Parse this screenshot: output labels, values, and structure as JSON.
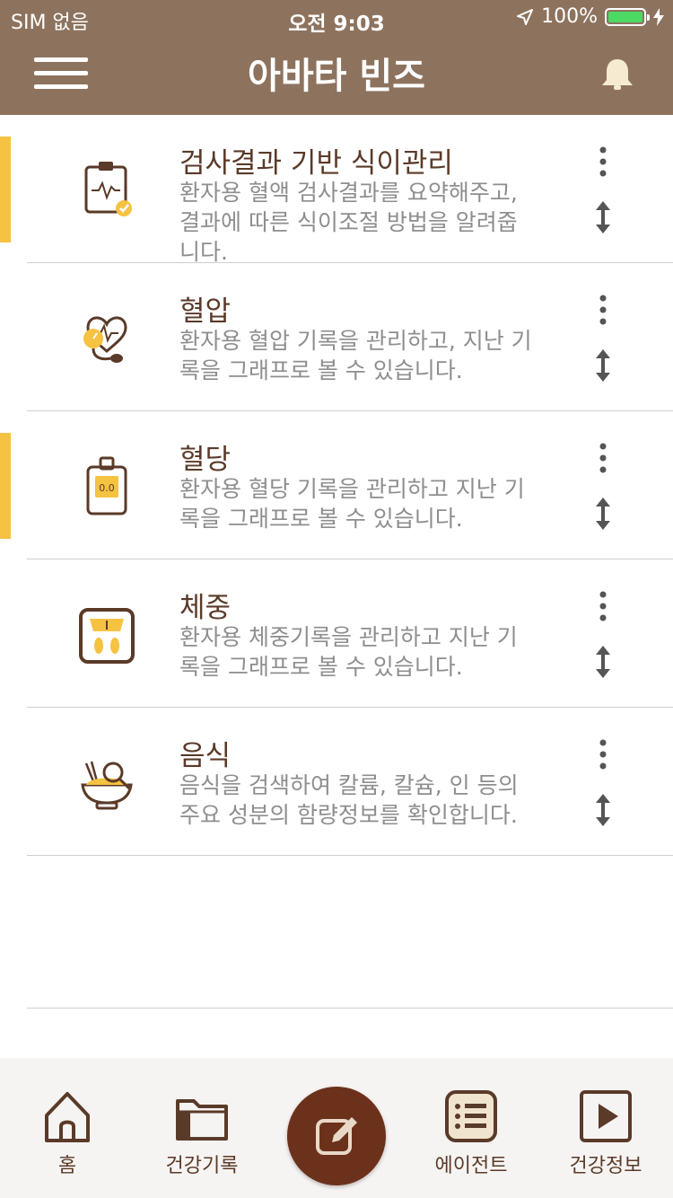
{
  "status_bar": {
    "carrier": "SIM 없음",
    "time": "오전 9:03",
    "battery": "100%"
  },
  "app_bar": {
    "title": "아바타 빈즈"
  },
  "items": [
    {
      "title": "검사결과 기반 식이관리",
      "description": "환자용 혈액 검사결과를 요약해주고,\n결과에 따른 식이조절 방법을 알려줍\n니다.",
      "icon": "clipboard-check-icon",
      "highlighted": true
    },
    {
      "title": "혈압",
      "description": "환자용 혈압 기록을 관리하고, 지난 기\n록을 그래프로 볼 수 있습니다.",
      "icon": "blood-pressure-icon",
      "highlighted": false
    },
    {
      "title": "혈당",
      "description": "환자용 혈당 기록을 관리하고 지난 기\n록을 그래프로 볼 수 있습니다.",
      "icon": "glucose-meter-icon",
      "icon_text": "0.0",
      "highlighted": true
    },
    {
      "title": "체중",
      "description": "환자용 체중기록을 관리하고 지난 기\n록을 그래프로 볼 수 있습니다.",
      "icon": "scale-icon",
      "highlighted": false
    },
    {
      "title": "음식",
      "description": "음식을 검색하여 칼륨, 칼슘, 인 등의\n주요 성분의 함량정보를 확인합니다.",
      "icon": "food-search-icon",
      "highlighted": false
    }
  ],
  "tab_bar": {
    "home": "홈",
    "health_record": "건강기록",
    "agent": "에이전트",
    "health_info": "건강정보"
  },
  "colors": {
    "header": "#8d735e",
    "accent": "#f5c242",
    "brown": "#5a3a28",
    "fab": "#6b311a"
  }
}
